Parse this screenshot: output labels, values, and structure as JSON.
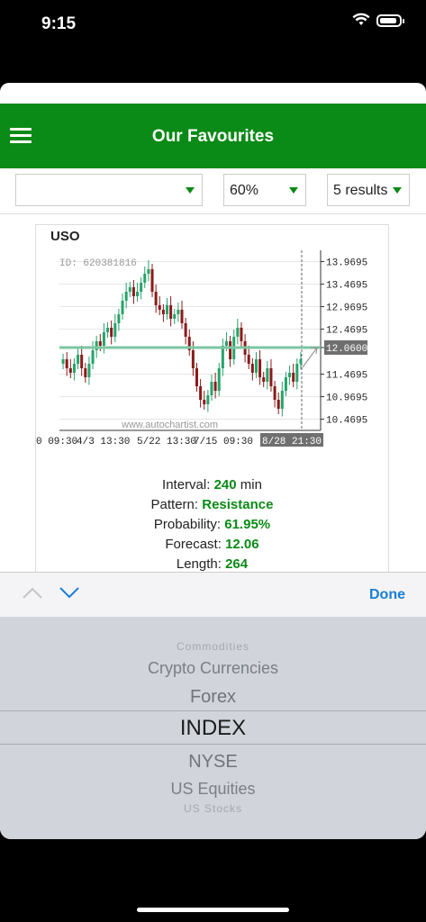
{
  "status_bar": {
    "time": "9:15"
  },
  "header": {
    "title": "Our Favourites"
  },
  "filters": {
    "category_value": "",
    "probability_value": "60%",
    "results_value": "5 results"
  },
  "card": {
    "symbol": "USO",
    "chart_id": "ID: 620381816",
    "watermark": "www.autochartist.com",
    "info": {
      "interval_label": "Interval:",
      "interval_value": "240",
      "interval_unit": "min",
      "pattern_label": "Pattern:",
      "pattern_value": "Resistance",
      "probability_label": "Probability:",
      "probability_value": "61.95%",
      "forecast_label": "Forecast:",
      "forecast_value": "12.06",
      "length_label": "Length:",
      "length_value": "264"
    }
  },
  "chart_data": {
    "type": "candlestick",
    "y_ticks": [
      "13.9695",
      "13.4695",
      "12.9695",
      "12.4695",
      "12.0600",
      "11.4695",
      "10.9695",
      "10.4695"
    ],
    "x_ticks": [
      "0 09:30",
      "4/3 13:30",
      "5/22 13:30",
      "7/15 09:30",
      "8/28 21:30"
    ],
    "resistance_level": 12.06,
    "ylim": [
      10.3,
      14.1
    ],
    "close_series": [
      11.8,
      11.6,
      11.5,
      11.7,
      11.9,
      11.6,
      11.4,
      11.7,
      12.0,
      12.2,
      12.1,
      12.4,
      12.5,
      12.3,
      12.6,
      12.8,
      13.1,
      13.3,
      13.4,
      13.2,
      13.3,
      13.5,
      13.7,
      13.8,
      13.3,
      13.0,
      12.9,
      12.8,
      13.0,
      12.7,
      12.8,
      12.9,
      12.6,
      12.3,
      12.0,
      11.6,
      11.2,
      10.9,
      10.8,
      11.0,
      11.3,
      11.1,
      11.6,
      12.1,
      12.2,
      11.8,
      12.3,
      12.5,
      12.2,
      11.9,
      11.7,
      11.5,
      11.8,
      11.4,
      11.3,
      11.6,
      11.2,
      10.9,
      10.7,
      11.1,
      11.4,
      11.5,
      11.3,
      11.7,
      11.8
    ]
  },
  "toolbar": {
    "done_label": "Done"
  },
  "picker": {
    "options": [
      "Commodities",
      "Crypto Currencies",
      "Forex",
      "INDEX",
      "NYSE",
      "US Equities",
      "US Stocks"
    ],
    "selected": "INDEX"
  },
  "colors": {
    "brand": "#0a8a16",
    "bull": "#27a36a",
    "bear": "#8b1a1a",
    "resistance": "#7cc6a2",
    "link": "#1a7ed6"
  }
}
